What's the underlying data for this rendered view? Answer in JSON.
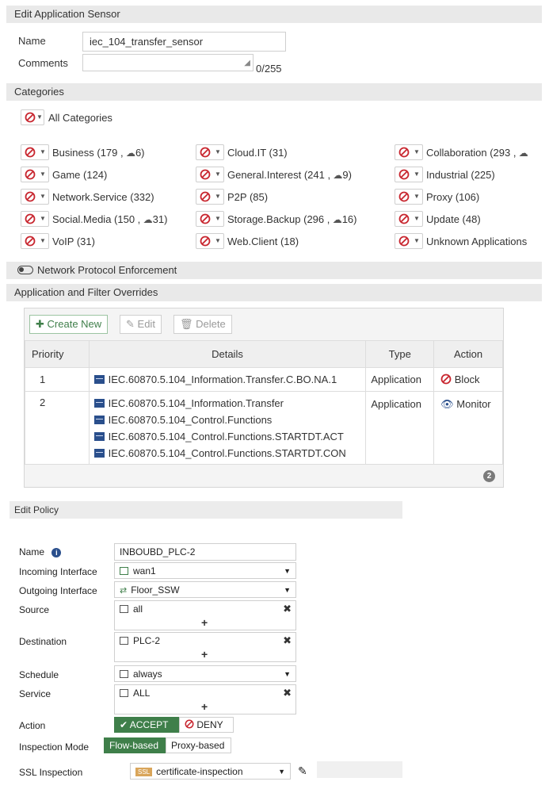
{
  "sensor": {
    "header": "Edit Application Sensor",
    "name_label": "Name",
    "name_value": "iec_104_transfer_sensor",
    "comments_label": "Comments",
    "comments_counter": "0/255"
  },
  "categories": {
    "header": "Categories",
    "all_label": "All Categories",
    "items": [
      {
        "label": "Business (179 ,",
        "cloud": "6)"
      },
      {
        "label": "Cloud.IT (31)",
        "cloud": ""
      },
      {
        "label": "Collaboration (293 ,",
        "cloud": ""
      },
      {
        "label": "Game (124)",
        "cloud": ""
      },
      {
        "label": "General.Interest (241 ,",
        "cloud": "9)"
      },
      {
        "label": "Industrial (225)",
        "cloud": ""
      },
      {
        "label": "Network.Service (332)",
        "cloud": ""
      },
      {
        "label": "P2P (85)",
        "cloud": ""
      },
      {
        "label": "Proxy (106)",
        "cloud": ""
      },
      {
        "label": "Social.Media (150 ,",
        "cloud": "31)"
      },
      {
        "label": "Storage.Backup (296 ,",
        "cloud": "16)"
      },
      {
        "label": "Update (48)",
        "cloud": ""
      },
      {
        "label": "VoIP (31)",
        "cloud": ""
      },
      {
        "label": "Web.Client (18)",
        "cloud": ""
      },
      {
        "label": "Unknown Applications",
        "cloud": ""
      }
    ]
  },
  "enforcement": {
    "label": "Network Protocol Enforcement"
  },
  "overrides": {
    "header": "Application and Filter Overrides",
    "toolbar": {
      "create": "Create New",
      "edit": "Edit",
      "delete": "Delete"
    },
    "columns": {
      "priority": "Priority",
      "details": "Details",
      "type": "Type",
      "action": "Action"
    },
    "rows": [
      {
        "priority": "1",
        "details": [
          "IEC.60870.5.104_Information.Transfer.C.BO.NA.1"
        ],
        "type": "Application",
        "action": "Block"
      },
      {
        "priority": "2",
        "details": [
          "IEC.60870.5.104_Information.Transfer",
          "IEC.60870.5.104_Control.Functions",
          "IEC.60870.5.104_Control.Functions.STARTDT.ACT",
          "IEC.60870.5.104_Control.Functions.STARTDT.CON"
        ],
        "type": "Application",
        "action": "Monitor"
      }
    ],
    "footer_count": "2"
  },
  "policy": {
    "header": "Edit Policy",
    "name_label": "Name",
    "name_value": "INBOUBD_PLC-2",
    "incoming_label": "Incoming Interface",
    "incoming_value": "wan1",
    "outgoing_label": "Outgoing Interface",
    "outgoing_value": "Floor_SSW",
    "source_label": "Source",
    "source_value": "all",
    "destination_label": "Destination",
    "destination_value": "PLC-2",
    "schedule_label": "Schedule",
    "schedule_value": "always",
    "service_label": "Service",
    "service_value": "ALL",
    "action_label": "Action",
    "accept": "ACCEPT",
    "deny": "DENY",
    "inspection_label": "Inspection Mode",
    "flow": "Flow-based",
    "proxy": "Proxy-based",
    "ssl_label": "SSL Inspection",
    "ssl_badge": "SSL",
    "ssl_value": "certificate-inspection"
  },
  "colors": {
    "green": "#3f7f4a",
    "red": "#c8262f",
    "blue": "#2a4f8c"
  }
}
